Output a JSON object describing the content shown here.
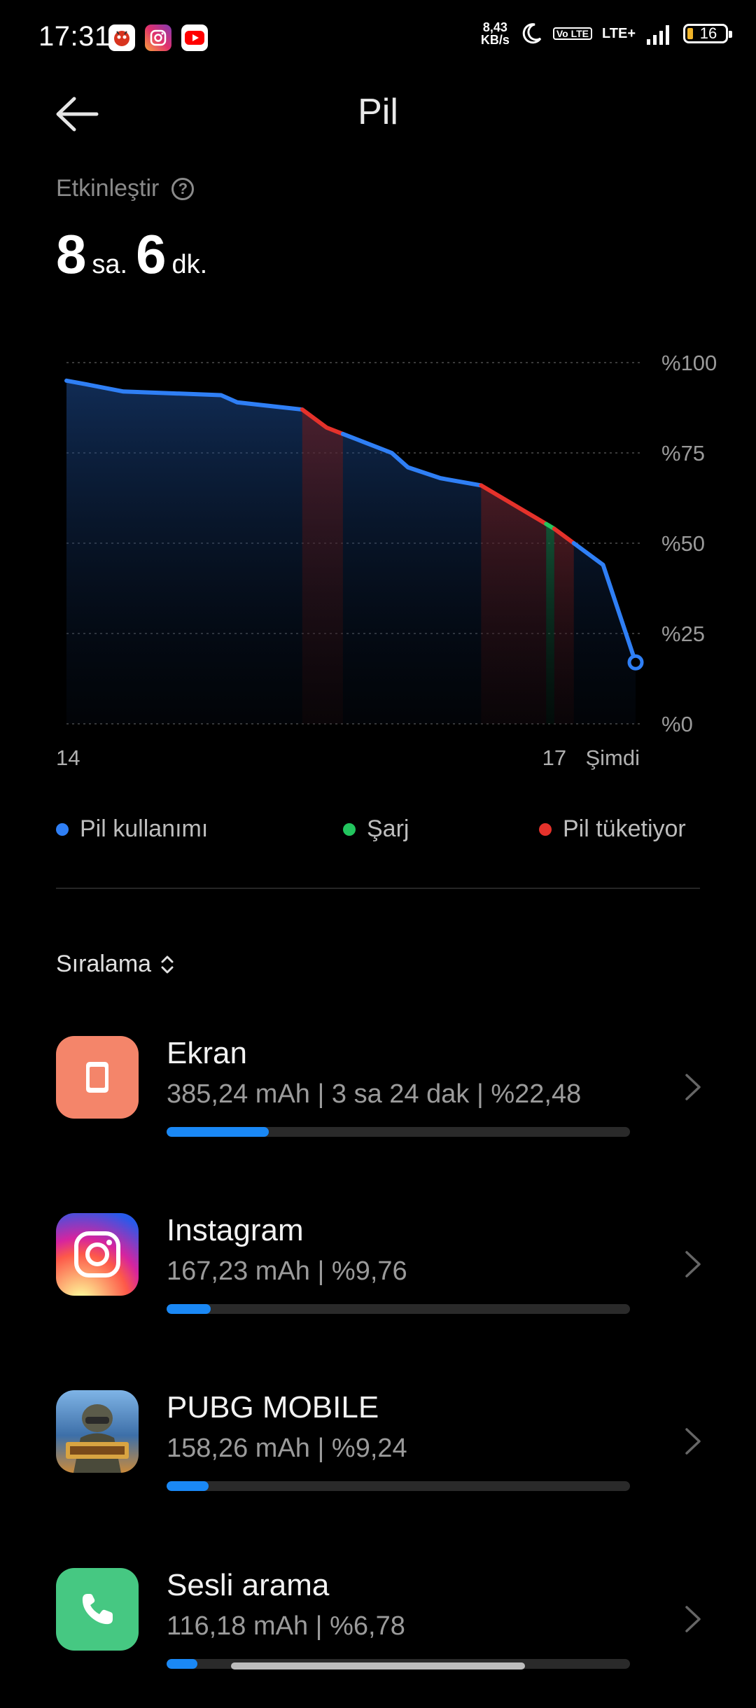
{
  "status_bar": {
    "time": "17:31",
    "speed_value": "8,43",
    "speed_unit": "KB/s",
    "volte": "Vo LTE",
    "network": "LTE+",
    "battery": "16"
  },
  "header": {
    "title": "Pil"
  },
  "estimate": {
    "label": "Etkinleştir",
    "hours": "8",
    "hours_unit": "sa.",
    "minutes": "6",
    "minutes_unit": "dk."
  },
  "chart_data": {
    "type": "line",
    "y_tick_labels": [
      "%100",
      "%75",
      "%50",
      "%25",
      "%0"
    ],
    "x_tick_labels": [
      "14",
      "17",
      "Şimdi"
    ],
    "ylim": [
      0,
      100
    ],
    "grid": true,
    "x_hours": [
      14.0,
      14.12,
      14.35,
      14.95,
      15.05,
      15.45,
      15.6,
      16.0,
      16.1,
      16.3,
      16.55,
      17.0,
      17.3,
      17.5
    ],
    "values": [
      95,
      94,
      92,
      91,
      89,
      87,
      82,
      75,
      71,
      68,
      66,
      54,
      44,
      17
    ],
    "segments": [
      {
        "series": "usage",
        "from_hour": 14.0,
        "to_hour": 15.45
      },
      {
        "series": "draining",
        "from_hour": 15.45,
        "to_hour": 15.7
      },
      {
        "series": "usage",
        "from_hour": 15.7,
        "to_hour": 16.55
      },
      {
        "series": "draining",
        "from_hour": 16.55,
        "to_hour": 16.95
      },
      {
        "series": "charging",
        "from_hour": 16.95,
        "to_hour": 17.0
      },
      {
        "series": "draining",
        "from_hour": 17.0,
        "to_hour": 17.12
      },
      {
        "series": "usage",
        "from_hour": 17.12,
        "to_hour": 17.5
      }
    ],
    "series_colors": {
      "usage": "#2f7ff5",
      "charging": "#22c55e",
      "draining": "#e5322b"
    }
  },
  "legend": {
    "usage": "Pil kullanımı",
    "charging": "Şarj",
    "draining": "Pil tüketiyor"
  },
  "sort": {
    "label": "Sıralama"
  },
  "apps": [
    {
      "name": "Ekran",
      "stat": "385,24 mAh | 3 sa 24 dak  | %22,48",
      "percent": 22.48,
      "icon": "screen-icon",
      "color": "#f4856a"
    },
    {
      "name": "Instagram",
      "stat": "167,23 mAh | %9,76",
      "percent": 9.76,
      "icon": "instagram-icon",
      "color": "#d62976"
    },
    {
      "name": "PUBG MOBILE",
      "stat": "158,26 mAh | %9,24",
      "percent": 9.24,
      "icon": "pubg-icon",
      "color": "#3d6fa8"
    },
    {
      "name": "Sesli arama",
      "stat": "116,18 mAh | %6,78",
      "percent": 6.78,
      "icon": "phone-icon",
      "color": "#46c882"
    }
  ]
}
